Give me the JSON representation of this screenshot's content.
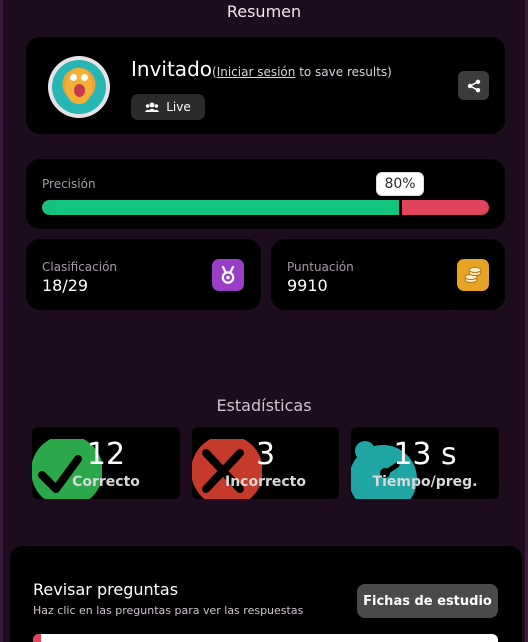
{
  "header": {
    "title": "Resumen"
  },
  "profile": {
    "name": "Invitado",
    "login_prefix": "(",
    "login_link": "Iniciar sesión",
    "login_suffix": " to save results)",
    "mode_badge": "Live",
    "avatar_icon": "avocado-avatar-icon",
    "share_icon": "share-icon"
  },
  "accuracy": {
    "label": "Precisión",
    "value_text": "80%",
    "value": 0.8,
    "colors": {
      "correct": "#12c47d",
      "incorrect": "#e2435c"
    }
  },
  "rank": {
    "label": "Clasificación",
    "value": "18/29",
    "icon": "medal-icon",
    "color": "#9a3ec7"
  },
  "score": {
    "label": "Puntuación",
    "value": "9910",
    "icon": "coins-icon",
    "color": "#e6a326"
  },
  "statistics": {
    "title": "Estadísticas",
    "tiles": [
      {
        "number": "12",
        "label": "Correcto",
        "icon": "check-icon",
        "color": "#2ba84a"
      },
      {
        "number": "3",
        "label": "Incorrecto",
        "icon": "cross-icon",
        "color": "#c63a2b"
      },
      {
        "number": "13 s",
        "label": "Tiempo/preg.",
        "icon": "timer-icon",
        "color": "#1fa6a4"
      }
    ]
  },
  "review": {
    "title": "Revisar preguntas",
    "subtitle": "Haz clic en las preguntas para ver las respuestas",
    "flashcards_button": "Fichas de estudio"
  }
}
